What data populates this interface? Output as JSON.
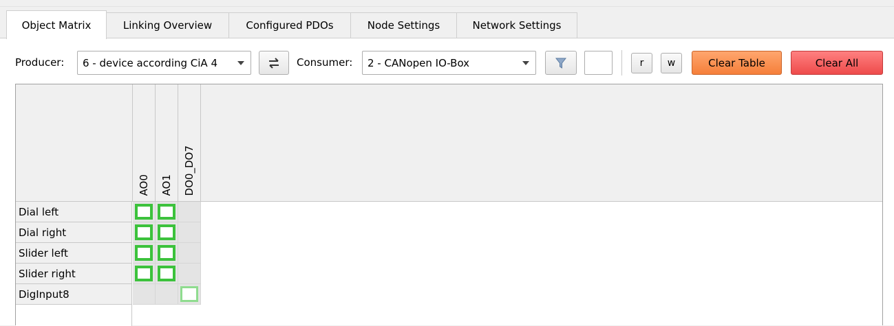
{
  "tabs": [
    {
      "label": "Object Matrix",
      "active": true
    },
    {
      "label": "Linking Overview",
      "active": false
    },
    {
      "label": "Configured PDOs",
      "active": false
    },
    {
      "label": "Node Settings",
      "active": false
    },
    {
      "label": "Network Settings",
      "active": false
    }
  ],
  "toolbar": {
    "producer_label": "Producer:",
    "producer_value": "6 - device according CiA 4",
    "swap_icon": "swap-arrows-icon",
    "consumer_label": "Consumer:",
    "consumer_value": "2 - CANopen IO-Box",
    "filter_icon": "funnel-filter-icon",
    "filter_value": "",
    "read_label": "r",
    "write_label": "w",
    "clear_table_label": "Clear Table",
    "clear_all_label": "Clear All",
    "colors": {
      "clear_table": "#f57f3a",
      "clear_all": "#ee4b4b",
      "linkable": "#3cc23c"
    }
  },
  "matrix": {
    "columns": [
      "AO0",
      "AO1",
      "DO0_DO7"
    ],
    "rows": [
      "Dial left",
      "Dial right",
      "Slider left",
      "Slider right",
      "DigInput8"
    ],
    "cells": [
      [
        "linkable",
        "linkable",
        "none"
      ],
      [
        "linkable",
        "linkable",
        "none"
      ],
      [
        "linkable",
        "linkable",
        "none"
      ],
      [
        "linkable",
        "linkable",
        "none"
      ],
      [
        "none",
        "none",
        "linkable-light"
      ]
    ]
  }
}
